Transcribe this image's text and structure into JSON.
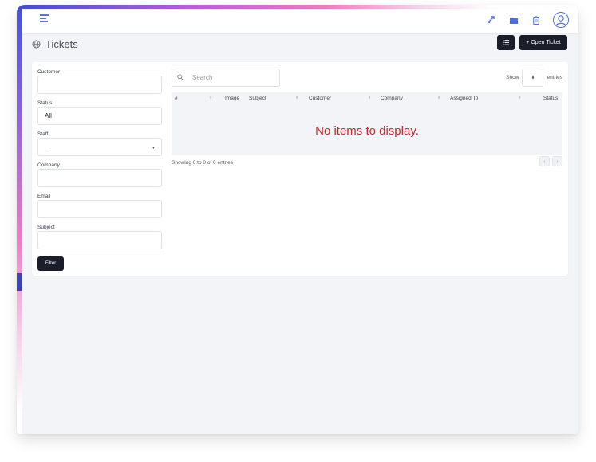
{
  "header": {
    "icons": [
      "menu-icon",
      "shuffle-icon",
      "folder-icon",
      "clipboard-icon",
      "user-avatar-icon"
    ]
  },
  "page": {
    "title": "Tickets",
    "list_button_icon": "list-icon",
    "open_ticket_label": "+ Open Ticket"
  },
  "filters": {
    "customer_label": "Customer",
    "customer_value": "",
    "status_label": "Status",
    "status_value": "All",
    "staff_label": "Staff",
    "staff_value": "---",
    "company_label": "Company",
    "company_value": "",
    "email_label": "Email",
    "email_value": "",
    "subject_label": "Subject",
    "subject_value": "",
    "filter_button": "Filter"
  },
  "table": {
    "search_placeholder": "Search",
    "show_label": "Show",
    "entries_label": "entries",
    "page_size": "",
    "columns": [
      "#",
      "Image",
      "Subject",
      "Customer",
      "Company",
      "Assigned To",
      "Status"
    ],
    "empty_message": "No items to display.",
    "showing_text": "Showing 0 to 0 of 0 entries",
    "prev": "‹",
    "next": "›"
  },
  "colors": {
    "accent": "#1b1d2b",
    "empty_text": "#c62828",
    "brand_blue": "#4f6fe0"
  }
}
